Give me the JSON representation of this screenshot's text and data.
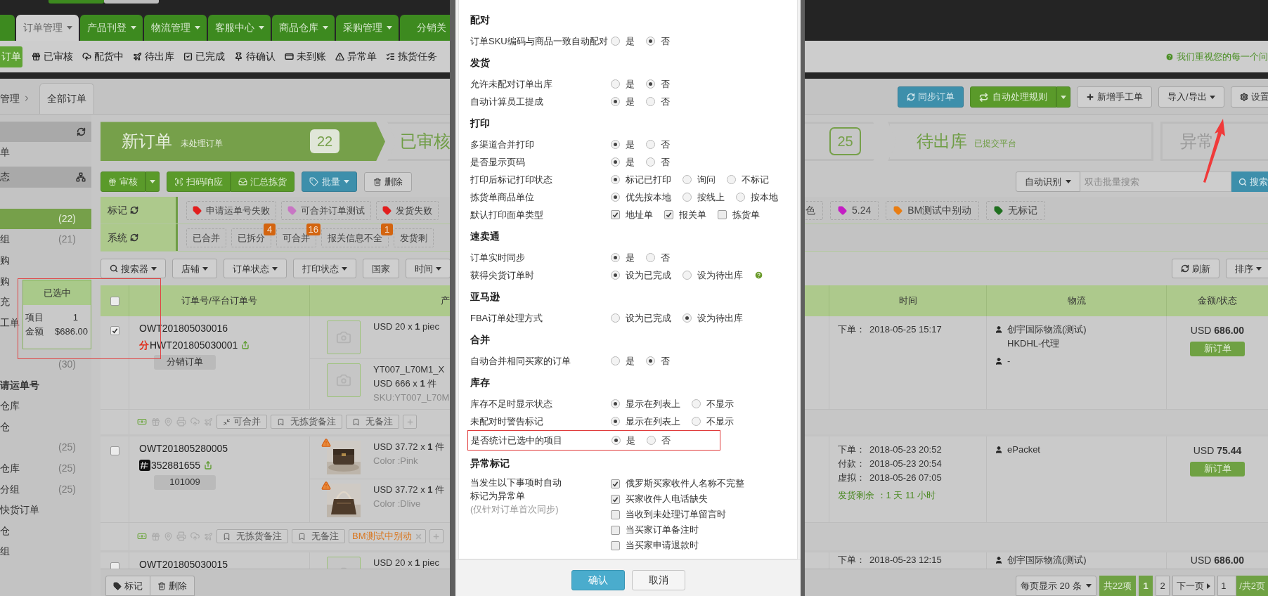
{
  "top_nav": {
    "tabs": [
      {
        "label": "订单管理",
        "selected": true,
        "caret": true
      },
      {
        "label": "产品刊登",
        "selected": false,
        "caret": true
      },
      {
        "label": "物流管理",
        "selected": false,
        "caret": true
      },
      {
        "label": "客服中心",
        "selected": false,
        "caret": true
      },
      {
        "label": "商品仓库",
        "selected": false,
        "caret": true
      },
      {
        "label": "采购管理",
        "selected": false,
        "caret": true
      },
      {
        "label": "分销关",
        "selected": false,
        "caret": false
      }
    ]
  },
  "sub_nav": {
    "items": [
      {
        "label": "订单",
        "selected": true
      },
      {
        "label": "已审核",
        "selected": false
      },
      {
        "label": "配货中",
        "selected": false
      },
      {
        "label": "待出库",
        "selected": false
      },
      {
        "label": "已完成",
        "selected": false
      },
      {
        "label": "待确认",
        "selected": false
      },
      {
        "label": "未到账",
        "selected": false
      },
      {
        "label": "异常单",
        "selected": false
      },
      {
        "label": "拣货任务",
        "selected": false
      }
    ],
    "notice": "我们重视您的每一个问"
  },
  "breadcrumb": {
    "parent": "管理",
    "tab": "全部订单"
  },
  "toolbar": [
    {
      "label": "同步订单",
      "kind": "sync"
    },
    {
      "label": "自动处理规则",
      "kind": "rules"
    },
    {
      "label": "新增手工单",
      "kind": "add"
    },
    {
      "label": "导入/导出",
      "kind": "dropdown"
    },
    {
      "label": "设置",
      "kind": "settings"
    }
  ],
  "pipeline": {
    "stages": [
      {
        "title": "新订单",
        "subtitle": "未处理订单",
        "count": "22",
        "selected": true
      },
      {
        "title": "已审核",
        "count": "25",
        "selected": false
      },
      {
        "title": "待出库",
        "subtitle": "已提交平台",
        "selected": false
      },
      {
        "title": "异常",
        "selected": false
      }
    ]
  },
  "sidebar": {
    "top_items": [
      {
        "label": "单",
        "selected": false
      }
    ],
    "group": "态",
    "items": [
      {
        "count": "(22)",
        "selected": true
      },
      {
        "label": "组",
        "count": "(21)",
        "selected": false
      },
      {
        "label": "购",
        "selected": false
      },
      {
        "label": "购",
        "selected": false
      },
      {
        "label": "充",
        "selected": false
      },
      {
        "label": "工单",
        "selected": false
      }
    ],
    "more_items": [
      {
        "kind": "item",
        "count": "(30)",
        "selected": false
      },
      {
        "kind": "group",
        "label": "请运单号"
      },
      {
        "kind": "item",
        "label": "仓库",
        "selected": false
      },
      {
        "kind": "item",
        "label": "仓",
        "selected": false
      },
      {
        "kind": "item",
        "count": "(25)",
        "selected": false
      },
      {
        "kind": "item",
        "label": "仓库",
        "count": "(25)",
        "selected": false
      },
      {
        "kind": "item",
        "label": "分组",
        "count": "(25)",
        "selected": false
      },
      {
        "kind": "item",
        "label": "快货订单",
        "selected": false
      },
      {
        "kind": "item",
        "label": "仓",
        "selected": false
      },
      {
        "kind": "item",
        "label": "组",
        "selected": false
      }
    ]
  },
  "actions": [
    {
      "label": "审核",
      "kind": "split"
    },
    {
      "label": "扫码响应",
      "kind": "scan"
    },
    {
      "label": "汇总拣货",
      "kind": "pick"
    },
    {
      "label": "批量",
      "kind": "menu"
    },
    {
      "label": "删除",
      "kind": "delete"
    }
  ],
  "search": {
    "mode": "自动识别",
    "placeholder": "双击批量搜索",
    "button": "搜索"
  },
  "mark_filter": {
    "label": "标记",
    "tags": [
      {
        "label": "申请运单号失败",
        "color": "#e21d1d"
      },
      {
        "label": "可合并订单测试",
        "color": "#c875c4"
      },
      {
        "label": "发货失败",
        "color": "#e21d1d"
      }
    ],
    "right_tags": [
      {
        "label": "色"
      },
      {
        "label": "5.24",
        "color": "#c41dc4"
      },
      {
        "label": "BM测试中别动",
        "color": "#e97d12"
      },
      {
        "label": "无标记",
        "color": "#1f6f1f"
      }
    ]
  },
  "system_filter": {
    "label": "系统",
    "tags": [
      {
        "label": "已合并"
      },
      {
        "label": "已拆分",
        "badge": "4"
      },
      {
        "label": "可合并",
        "badge": "16"
      },
      {
        "label": "报关信息不全",
        "badge": "1"
      },
      {
        "label": "发货剩"
      }
    ]
  },
  "filters": [
    {
      "label": "搜索器",
      "kind": "search"
    },
    {
      "label": "店铺",
      "kind": "dropdown"
    },
    {
      "label": "订单状态",
      "kind": "dropdown"
    },
    {
      "label": "打印状态",
      "kind": "dropdown"
    },
    {
      "label": "国家",
      "kind": "plain"
    },
    {
      "label": "时间",
      "kind": "dropdown"
    }
  ],
  "view_controls": [
    {
      "label": "刷新",
      "kind": "refresh"
    },
    {
      "label": "排序",
      "kind": "dropdown"
    }
  ],
  "table": {
    "select_all": false,
    "columns": [
      "订单号/平台订单号",
      "产",
      "时间",
      "物流",
      "金额/状态"
    ],
    "rows": [
      {
        "checked": true,
        "order_no": "OWT201805030016",
        "platform_mark": "分",
        "platform_no": "HWT201805030001",
        "tag": "分销订单",
        "products": [
          {
            "kind": "placeholder",
            "lines": [
              {
                "text": "USD 20 x **1** piec",
                "muted": false
              }
            ]
          },
          {
            "kind": "placeholder",
            "lines": [
              {
                "text": "YT007_L70M1_X",
                "muted": false
              },
              {
                "text": "USD 666 x **1** 件",
                "muted": false
              },
              {
                "text": "SKU:YT007_L70M",
                "muted": true
              }
            ]
          }
        ],
        "times": [
          {
            "label": "下单：",
            "value": "2018-05-25 15:17"
          }
        ],
        "logistics": {
          "carrier": "创宇国际物流(测试)",
          "service": "HKDHL-代理",
          "tracking": "-"
        },
        "amount": "USD **686.00**",
        "status": "新订单",
        "actions": [
          {
            "kind": "merge",
            "label": "可合并"
          },
          {
            "kind": "note",
            "label": "无拣货备注"
          },
          {
            "kind": "note",
            "label": "无备注"
          },
          {
            "kind": "add"
          }
        ]
      },
      {
        "checked": false,
        "order_no": "OWT201805280005",
        "platform_no": "352881655",
        "tag": "101009",
        "products": [
          {
            "warning": true,
            "lines": [
              {
                "text": "USD 37.72 x **1** 件",
                "muted": false
              },
              {
                "text": "Color :Pink",
                "muted": true
              }
            ]
          },
          {
            "warning": true,
            "lines": [
              {
                "text": "USD 37.72 x **1** 件",
                "muted": false
              },
              {
                "text": "Color :Dlive",
                "muted": true
              }
            ]
          }
        ],
        "times": [
          {
            "label": "下单：",
            "value": "2018-05-23 20:52"
          },
          {
            "label": "付款：",
            "value": "2018-05-23 20:54"
          },
          {
            "label": "虚拟：",
            "value": "2018-05-26 07:05"
          }
        ],
        "remaining": "发货剩余 ：1 天 11 小时",
        "logistics": {
          "carrier": "ePacket"
        },
        "amount": "USD **75.44**",
        "status": "新订单",
        "actions": [
          {
            "kind": "note",
            "label": "无拣货备注"
          },
          {
            "kind": "note",
            "label": "无备注"
          },
          {
            "kind": "mark",
            "label": "BM测试中别动"
          },
          {
            "kind": "add"
          }
        ]
      },
      {
        "checked": false,
        "order_no": "OWT201805030015",
        "products": [
          {
            "kind": "placeholder",
            "lines": [
              {
                "text": "USD 20 x **1** piec",
                "muted": false
              }
            ]
          }
        ],
        "times": [
          {
            "label": "下单：",
            "value": "2018-05-23 12:15"
          }
        ],
        "logistics": {
          "carrier": "创宇国际物流(测试)"
        },
        "amount": "USD **686.00**"
      }
    ]
  },
  "bottom_actions": [
    {
      "label": "标记",
      "kind": "tag"
    },
    {
      "label": "删除",
      "kind": "delete"
    }
  ],
  "pagination": {
    "page_size": "每页显示 20 条",
    "total": "共22项",
    "pages": [
      {
        "label": "1",
        "selected": true
      },
      {
        "label": "2",
        "selected": false
      }
    ],
    "next": "下一页",
    "page_input": "1",
    "page_count": "/共2页"
  },
  "selection_popup": {
    "title": "已选中",
    "rows": [
      {
        "label": "项目",
        "value": "1"
      },
      {
        "label": "金额",
        "value": "$686.00"
      }
    ],
    "highlighted": true
  },
  "modal": {
    "sections": [
      {
        "title": "配对",
        "rows": [
          {
            "label": "订单SKU编码与商品一致自动配对",
            "kind": "radio",
            "options": [
              {
                "label": "是",
                "selected": false
              },
              {
                "label": "否",
                "selected": true
              }
            ]
          }
        ]
      },
      {
        "title": "发货",
        "rows": [
          {
            "label": "允许未配对订单出库",
            "kind": "radio",
            "options": [
              {
                "label": "是",
                "selected": false
              },
              {
                "label": "否",
                "selected": true
              }
            ]
          },
          {
            "label": "自动计算员工提成",
            "kind": "radio",
            "options": [
              {
                "label": "是",
                "selected": true
              },
              {
                "label": "否",
                "selected": false
              }
            ]
          }
        ]
      },
      {
        "title": "打印",
        "rows": [
          {
            "label": "多渠道合并打印",
            "kind": "radio",
            "options": [
              {
                "label": "是",
                "selected": true
              },
              {
                "label": "否",
                "selected": false
              }
            ]
          },
          {
            "label": "是否显示页码",
            "kind": "radio",
            "options": [
              {
                "label": "是",
                "selected": true
              },
              {
                "label": "否",
                "selected": false
              }
            ]
          },
          {
            "label": "打印后标记打印状态",
            "kind": "radio",
            "options": [
              {
                "label": "标记已打印",
                "selected": true
              },
              {
                "label": "询问",
                "selected": false
              },
              {
                "label": "不标记",
                "selected": false
              }
            ]
          },
          {
            "label": "拣货单商品单位",
            "kind": "radio",
            "options": [
              {
                "label": "优先按本地",
                "selected": true
              },
              {
                "label": "按线上",
                "selected": false
              },
              {
                "label": "按本地",
                "selected": false
              }
            ]
          },
          {
            "label": "默认打印面单类型",
            "kind": "checkbox",
            "options": [
              {
                "label": "地址单",
                "checked": true
              },
              {
                "label": "报关单",
                "checked": true
              },
              {
                "label": "拣货单",
                "checked": false
              }
            ]
          }
        ]
      },
      {
        "title": "速卖通",
        "rows": [
          {
            "label": "订单实时同步",
            "kind": "radio",
            "options": [
              {
                "label": "是",
                "selected": true
              },
              {
                "label": "否",
                "selected": false
              }
            ]
          },
          {
            "label": "获得尖货订单时",
            "kind": "radio",
            "help": true,
            "options": [
              {
                "label": "设为已完成",
                "selected": true
              },
              {
                "label": "设为待出库",
                "selected": false
              }
            ]
          }
        ]
      },
      {
        "title": "亚马逊",
        "rows": [
          {
            "label": "FBA订单处理方式",
            "kind": "radio",
            "options": [
              {
                "label": "设为已完成",
                "selected": false
              },
              {
                "label": "设为待出库",
                "selected": true
              }
            ]
          }
        ]
      },
      {
        "title": "合并",
        "rows": [
          {
            "label": "自动合并相同买家的订单",
            "kind": "radio",
            "options": [
              {
                "label": "是",
                "selected": false
              },
              {
                "label": "否",
                "selected": true
              }
            ]
          }
        ]
      },
      {
        "title": "库存",
        "rows": [
          {
            "label": "库存不足时显示状态",
            "kind": "radio",
            "options": [
              {
                "label": "显示在列表上",
                "selected": true
              },
              {
                "label": "不显示",
                "selected": false
              }
            ]
          },
          {
            "label": "未配对时警告标记",
            "kind": "radio",
            "options": [
              {
                "label": "显示在列表上",
                "selected": true
              },
              {
                "label": "不显示",
                "selected": false
              }
            ]
          },
          {
            "label": "是否统计已选中的项目",
            "kind": "radio",
            "highlighted": true,
            "options": [
              {
                "label": "是",
                "selected": true
              },
              {
                "label": "否",
                "selected": false
              }
            ]
          }
        ]
      },
      {
        "title": "异常标记",
        "rows": [
          {
            "label": "当发生以下事项时自动标记为异常单",
            "note": "(仅针对订单首次同步)",
            "kind": "checklist",
            "options": [
              {
                "label": "俄罗斯买家收件人名称不完整",
                "checked": true
              },
              {
                "label": "买家收件人电话缺失",
                "checked": true
              },
              {
                "label": "当收到未处理订单留言时",
                "checked": false
              },
              {
                "label": "当买家订单备注时",
                "checked": false
              },
              {
                "label": "当买家申请退款时",
                "checked": false
              }
            ]
          }
        ]
      }
    ],
    "buttons": [
      {
        "label": "确认",
        "kind": "primary"
      },
      {
        "label": "取消",
        "kind": "default"
      }
    ]
  }
}
